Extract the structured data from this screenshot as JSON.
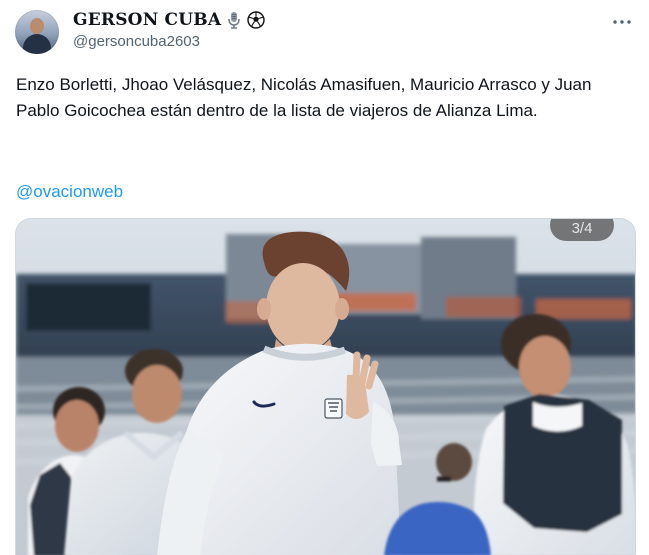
{
  "author": {
    "display_name": "GERSON CUBA",
    "handle": "@gersoncuba2603",
    "name_emojis": [
      "microphone-icon",
      "soccer-ball-icon"
    ]
  },
  "tweet": {
    "text": "Enzo Borletti, Jhoao Velásquez, Nicolás Amasifuen, Mauricio Arrasco y Juan Pablo Goicochea están dentro de la lista de viajeros de Alianza Lima.",
    "mention": "@ovacionweb"
  },
  "media": {
    "counter": "3/4"
  },
  "colors": {
    "link": "#1d9bf0",
    "secondary_text": "#536471",
    "text": "#0f1419"
  }
}
